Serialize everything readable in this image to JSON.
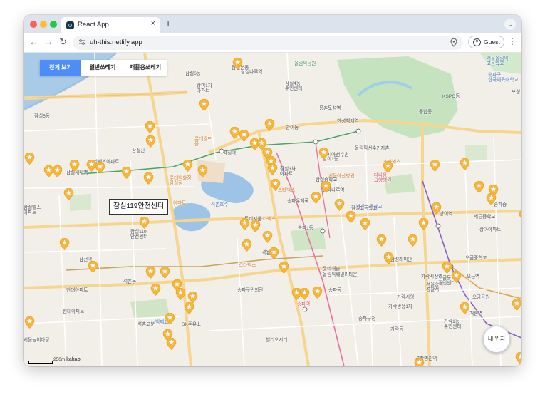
{
  "browser": {
    "tab_title": "React App",
    "tab_close": "×",
    "new_tab": "+",
    "tab_menu": "⌄",
    "back": "←",
    "forward": "→",
    "reload": "↻",
    "url": "uh-this.netlify.app",
    "profile_label": "Guest",
    "menu": "⋮",
    "colors": {
      "close": "#ff5f57",
      "minimize": "#febc2e",
      "maximize": "#28c840"
    }
  },
  "filters": {
    "items": [
      {
        "label": "전체 보기",
        "active": true
      },
      {
        "label": "일반쓰레기",
        "active": false
      },
      {
        "label": "재활용쓰레기",
        "active": false
      }
    ],
    "active_color": "#4e8cf7"
  },
  "map": {
    "callout": "잠실119안전센터",
    "my_location": "내 위치",
    "scale_label": "250m",
    "attribution": "kakao",
    "pin_color": "#f6b53b",
    "place_labels": [
      {
        "text": "서울올림픽\n고등학교"
      },
      {
        "text": "잠실나루역"
      },
      {
        "text": "송파구\n한국체육대학교"
      },
      {
        "text": "잠실6동"
      },
      {
        "text": "장미1차\n아파트"
      },
      {
        "text": "잠실4동\n주민센터"
      },
      {
        "text": "올림픽공원"
      },
      {
        "text": "KSPO돔"
      },
      {
        "text": "잠실5동"
      },
      {
        "text": "잠실신\n"
      },
      {
        "text": "잠실본동"
      },
      {
        "text": "잠실역"
      },
      {
        "text": "롯데월드\n몰"
      },
      {
        "text": "롯데백화점\n잠실점"
      },
      {
        "text": "석촌호수"
      },
      {
        "text": "방이동"
      },
      {
        "text": "몽촌토성역"
      },
      {
        "text": "한성백제역"
      },
      {
        "text": "올림픽선수기자촌"
      },
      {
        "text": "방이1동"
      },
      {
        "text": "서울아산병원"
      },
      {
        "text": "송파나루역"
      },
      {
        "text": "방산고등학교"
      },
      {
        "text": "송파1동"
      },
      {
        "text": "잠실3차\n아파트"
      },
      {
        "text": "잠실119\n안전센터"
      },
      {
        "text": "석촌역"
      },
      {
        "text": "송파역"
      },
      {
        "text": "삼전역"
      },
      {
        "text": "가락시장역"
      },
      {
        "text": "오금역"
      },
      {
        "text": "세륜중학교"
      },
      {
        "text": "방이역"
      },
      {
        "text": "개롱역"
      },
      {
        "text": "송파구청"
      },
      {
        "text": "가락동"
      },
      {
        "text": "문정동"
      },
      {
        "text": "석촌동"
      },
      {
        "text": "SK주유소"
      },
      {
        "text": "경찰병원역"
      },
      {
        "text": "서울놀이마당"
      },
      {
        "text": "백제고분"
      },
      {
        "text": "현대아파트"
      },
      {
        "text": "삼성래미안"
      },
      {
        "text": "헬리오시티"
      },
      {
        "text": "풍납동"
      },
      {
        "text": "송파동"
      },
      {
        "text": "가락1동\n주민센터"
      },
      {
        "text": "오금동\n주민센터"
      },
      {
        "text": "송파우체국"
      },
      {
        "text": "잠실새내역"
      },
      {
        "text": "스타벅스"
      },
      {
        "text": "스타벅스"
      },
      {
        "text": "스타벅스"
      },
      {
        "text": "스타벅스"
      },
      {
        "text": "이마트"
      },
      {
        "text": "다나음\n요양병원"
      },
      {
        "text": "서울송파\n경찰서"
      },
      {
        "text": "롯데캐슬"
      },
      {
        "text": "가락쌍용1차"
      },
      {
        "text": "올림픽훼밀리타운"
      },
      {
        "text": "송파구민회관"
      },
      {
        "text": "잠실엘스\n아파트"
      },
      {
        "text": "리센츠아파트"
      },
      {
        "text": "트리지움"
      },
      {
        "text": "아시아선수촌"
      },
      {
        "text": "현대아파트"
      },
      {
        "text": "가락시영"
      },
      {
        "text": "송파중"
      },
      {
        "text": "보성고"
      },
      {
        "text": "오금중학교"
      },
      {
        "text": "오금공원"
      },
      {
        "text": "상아아파트"
      },
      {
        "text": "잠실고등학교"
      },
      {
        "text": "잠실중학교"
      },
      {
        "text": "석촌고분"
      }
    ]
  }
}
